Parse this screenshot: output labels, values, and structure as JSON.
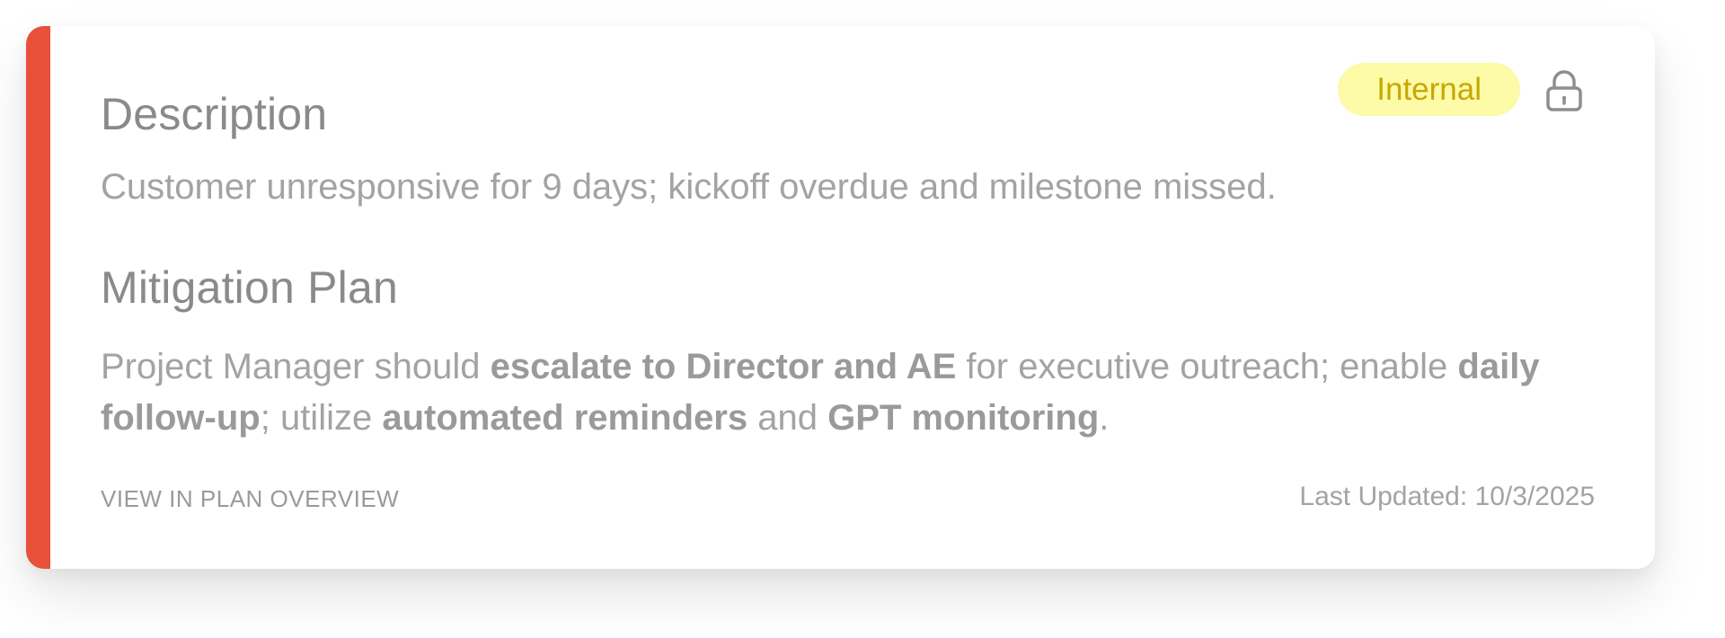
{
  "card": {
    "accent_color": "#e8503a",
    "badge": {
      "label": "Internal",
      "background": "#fdfaa8",
      "color": "#c7a800"
    },
    "lock_icon": "lock-icon",
    "description": {
      "heading": "Description",
      "text": "Customer unresponsive for 9 days; kickoff overdue and milestone missed."
    },
    "mitigation": {
      "heading": "Mitigation Plan",
      "segments": [
        {
          "text": "Project Manager should ",
          "bold": false
        },
        {
          "text": "escalate to Director and AE",
          "bold": true
        },
        {
          "text": " for executive outreach; enable ",
          "bold": false
        },
        {
          "text": "daily follow-up",
          "bold": true
        },
        {
          "text": "; utilize ",
          "bold": false
        },
        {
          "text": "automated reminders",
          "bold": true
        },
        {
          "text": " and ",
          "bold": false
        },
        {
          "text": "GPT monitoring",
          "bold": true
        },
        {
          "text": ".",
          "bold": false
        }
      ]
    },
    "footer": {
      "link_label": "VIEW IN PLAN OVERVIEW",
      "last_updated": "Last Updated: 10/3/2025"
    }
  }
}
